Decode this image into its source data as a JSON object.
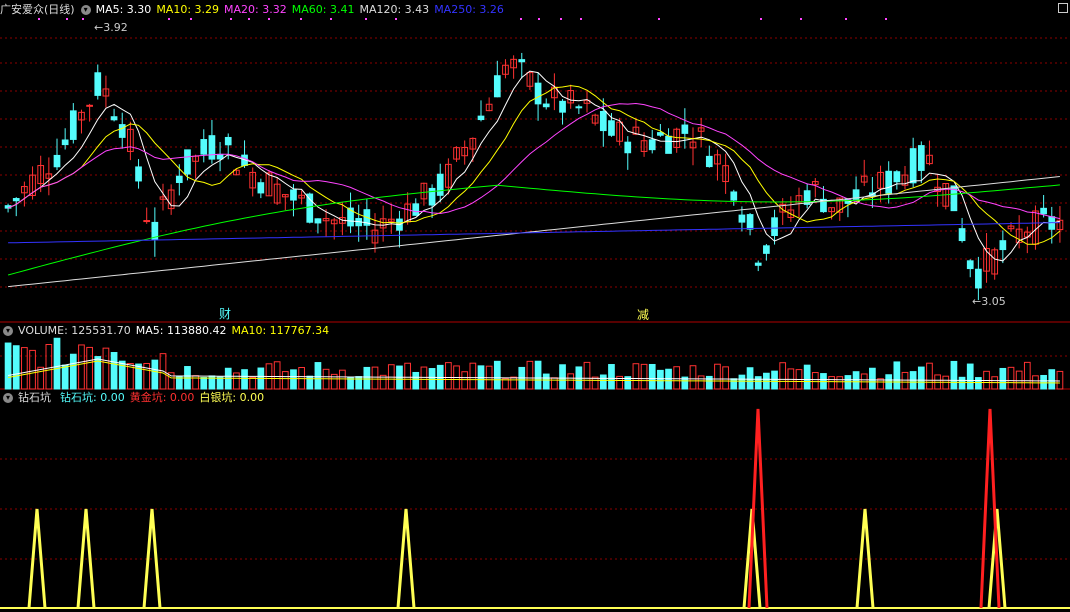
{
  "main_panel": {
    "stock_name": "广安爱众(日线)",
    "indicators": [
      {
        "label": "MA5: 3.30",
        "color": "#ffffff"
      },
      {
        "label": "MA10: 3.29",
        "color": "#ffff00"
      },
      {
        "label": "MA20: 3.32",
        "color": "#ff44ff"
      },
      {
        "label": "MA60: 3.41",
        "color": "#00ff00"
      },
      {
        "label": "MA120: 3.43",
        "color": "#dddddd"
      },
      {
        "label": "MA250: 3.26",
        "color": "#3333ff"
      }
    ],
    "high_marker": "3.92",
    "low_marker": "3.05",
    "tag_cai": "财",
    "tag_jian": "减"
  },
  "volume_panel": {
    "title": "VOLUME: 125531.70",
    "ma5": "MA5: 113880.42",
    "ma10": "MA10: 117767.34"
  },
  "indicator_panel": {
    "name": "钻石坑",
    "values": [
      {
        "label": "钻石坑: 0.00",
        "color": "#54fcfc"
      },
      {
        "label": "黄金坑: 0.00",
        "color": "#ff3030"
      },
      {
        "label": "白银坑: 0.00",
        "color": "#ffff54"
      }
    ]
  },
  "colors": {
    "up": "#ff3232",
    "down": "#54fcfc",
    "grid": "#8b0000",
    "divider": "#b00000"
  },
  "chart_data": {
    "type": "candlestick",
    "count": 130,
    "price_high": 3.92,
    "price_low": 3.05,
    "price_last": 3.3,
    "ma_last": {
      "MA5": 3.3,
      "MA10": 3.29,
      "MA20": 3.32,
      "MA60": 3.41,
      "MA120": 3.43,
      "MA250": 3.26
    },
    "volume_last": 125531.7,
    "volume_ma5": 113880.42,
    "volume_ma10": 117767.34,
    "signals": {
      "yellow_spikes_at": [
        4,
        11,
        18,
        48,
        89,
        102,
        118
      ],
      "red_spikes_at": [
        90,
        117
      ]
    }
  }
}
